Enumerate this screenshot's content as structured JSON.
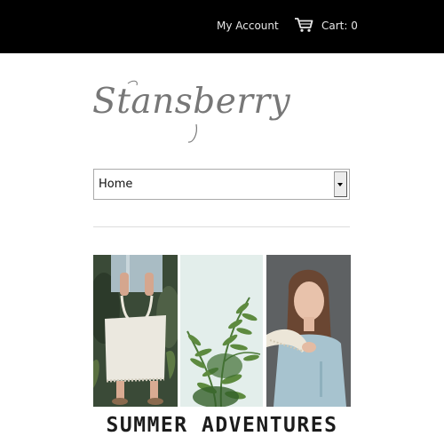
{
  "header": {
    "account_label": "My Account",
    "cart_icon": "shopping-cart-icon",
    "cart_label": "Cart: 0"
  },
  "brand": {
    "logo_text": "Stansberry"
  },
  "navigation": {
    "selected": "Home"
  },
  "banner": {
    "caption": "SUMMER ADVENTURES"
  },
  "colors": {
    "topbar": "#000000",
    "header_text": "#e6e6e6",
    "logo": "#777777"
  }
}
